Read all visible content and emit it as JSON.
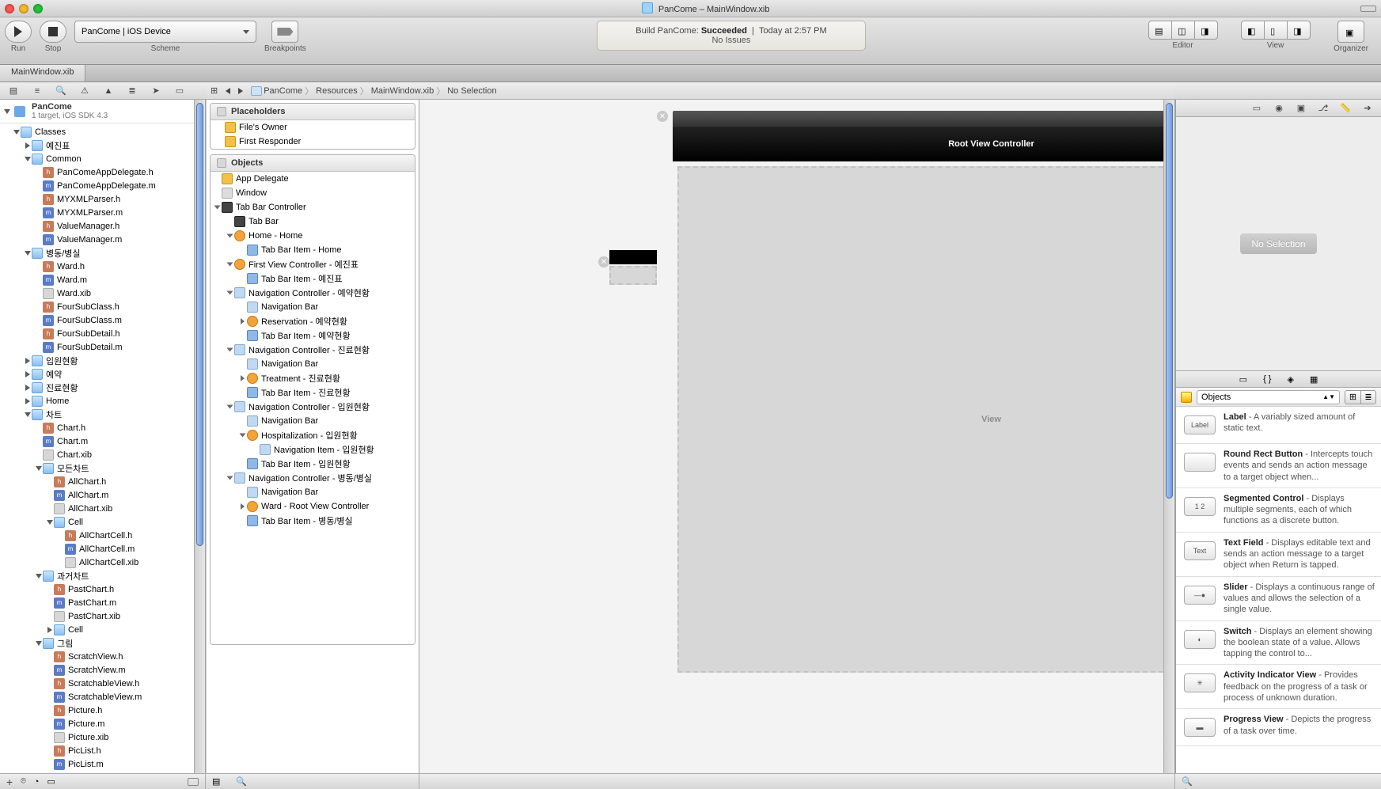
{
  "title": "PanCome – MainWindow.xib",
  "toolbar": {
    "run": "Run",
    "stop": "Stop",
    "scheme_label": "Scheme",
    "scheme_value": "PanCome | iOS Device",
    "breakpoints": "Breakpoints",
    "editor": "Editor",
    "view": "View",
    "organizer": "Organizer",
    "activity_prefix": "Build PanCome: ",
    "activity_status": "Succeeded",
    "activity_time": "Today at 2:57 PM",
    "activity_sub": "No Issues"
  },
  "tab": "MainWindow.xib",
  "breadcrumb": [
    "PanCome",
    "Resources",
    "MainWindow.xib",
    "No Selection"
  ],
  "project": {
    "name": "PanCome",
    "sub": "1 target, iOS SDK 4.3"
  },
  "navTree": [
    {
      "d": 1,
      "t": "folder",
      "o": true,
      "l": "Classes"
    },
    {
      "d": 2,
      "t": "folder",
      "o": false,
      "l": "예진표"
    },
    {
      "d": 2,
      "t": "folder",
      "o": true,
      "l": "Common"
    },
    {
      "d": 3,
      "t": "h",
      "l": "PanComeAppDelegate.h"
    },
    {
      "d": 3,
      "t": "m",
      "l": "PanComeAppDelegate.m"
    },
    {
      "d": 3,
      "t": "h",
      "l": "MYXMLParser.h"
    },
    {
      "d": 3,
      "t": "m",
      "l": "MYXMLParser.m"
    },
    {
      "d": 3,
      "t": "h",
      "l": "ValueManager.h"
    },
    {
      "d": 3,
      "t": "m",
      "l": "ValueManager.m"
    },
    {
      "d": 2,
      "t": "folder",
      "o": true,
      "l": "병동/병실"
    },
    {
      "d": 3,
      "t": "h",
      "l": "Ward.h"
    },
    {
      "d": 3,
      "t": "m",
      "l": "Ward.m"
    },
    {
      "d": 3,
      "t": "xib",
      "l": "Ward.xib"
    },
    {
      "d": 3,
      "t": "h",
      "l": "FourSubClass.h"
    },
    {
      "d": 3,
      "t": "m",
      "l": "FourSubClass.m"
    },
    {
      "d": 3,
      "t": "h",
      "l": "FourSubDetail.h"
    },
    {
      "d": 3,
      "t": "m",
      "l": "FourSubDetail.m"
    },
    {
      "d": 2,
      "t": "folder",
      "o": false,
      "l": "입원현황"
    },
    {
      "d": 2,
      "t": "folder",
      "o": false,
      "l": "예약"
    },
    {
      "d": 2,
      "t": "folder",
      "o": false,
      "l": "진료현황"
    },
    {
      "d": 2,
      "t": "folder",
      "o": false,
      "l": "Home"
    },
    {
      "d": 2,
      "t": "folder",
      "o": true,
      "l": "차트"
    },
    {
      "d": 3,
      "t": "h",
      "l": "Chart.h"
    },
    {
      "d": 3,
      "t": "m",
      "l": "Chart.m"
    },
    {
      "d": 3,
      "t": "xib",
      "l": "Chart.xib"
    },
    {
      "d": 3,
      "t": "folder",
      "o": true,
      "l": "모든차트"
    },
    {
      "d": 4,
      "t": "h",
      "l": "AllChart.h"
    },
    {
      "d": 4,
      "t": "m",
      "l": "AllChart.m"
    },
    {
      "d": 4,
      "t": "xib",
      "l": "AllChart.xib"
    },
    {
      "d": 4,
      "t": "folder",
      "o": true,
      "l": "Cell"
    },
    {
      "d": 5,
      "t": "h",
      "l": "AllChartCell.h"
    },
    {
      "d": 5,
      "t": "m",
      "l": "AllChartCell.m"
    },
    {
      "d": 5,
      "t": "xib",
      "l": "AllChartCell.xib"
    },
    {
      "d": 3,
      "t": "folder",
      "o": true,
      "l": "과거차트"
    },
    {
      "d": 4,
      "t": "h",
      "l": "PastChart.h"
    },
    {
      "d": 4,
      "t": "m",
      "l": "PastChart.m"
    },
    {
      "d": 4,
      "t": "xib",
      "l": "PastChart.xib"
    },
    {
      "d": 4,
      "t": "folder",
      "o": false,
      "l": "Cell"
    },
    {
      "d": 3,
      "t": "folder",
      "o": true,
      "l": "그림"
    },
    {
      "d": 4,
      "t": "h",
      "l": "ScratchView.h"
    },
    {
      "d": 4,
      "t": "m",
      "l": "ScratchView.m"
    },
    {
      "d": 4,
      "t": "h",
      "l": "ScratchableView.h"
    },
    {
      "d": 4,
      "t": "m",
      "l": "ScratchableView.m"
    },
    {
      "d": 4,
      "t": "h",
      "l": "Picture.h"
    },
    {
      "d": 4,
      "t": "m",
      "l": "Picture.m"
    },
    {
      "d": 4,
      "t": "xib",
      "l": "Picture.xib"
    },
    {
      "d": 4,
      "t": "h",
      "l": "PicList.h"
    },
    {
      "d": 4,
      "t": "m",
      "l": "PicList.m"
    }
  ],
  "outline": {
    "placeholders": "Placeholders",
    "ph_items": [
      "File's Owner",
      "First Responder"
    ],
    "objects": "Objects",
    "obj_tree": [
      {
        "d": 0,
        "i": "cube",
        "l": "App Delegate"
      },
      {
        "d": 0,
        "i": "win",
        "l": "Window"
      },
      {
        "d": 0,
        "i": "bar",
        "o": true,
        "l": "Tab Bar Controller"
      },
      {
        "d": 1,
        "i": "bar",
        "l": "Tab Bar"
      },
      {
        "d": 1,
        "i": "orange",
        "o": true,
        "l": "Home - Home"
      },
      {
        "d": 2,
        "i": "blue",
        "l": "Tab Bar Item - Home"
      },
      {
        "d": 1,
        "i": "orange",
        "o": true,
        "l": "First View Controller - 예진표"
      },
      {
        "d": 2,
        "i": "blue",
        "l": "Tab Bar Item - 예진표"
      },
      {
        "d": 1,
        "i": "nav",
        "o": true,
        "l": "Navigation Controller - 예약현황"
      },
      {
        "d": 2,
        "i": "nav",
        "l": "Navigation Bar"
      },
      {
        "d": 2,
        "i": "orange",
        "o": false,
        "l": "Reservation - 예약현황"
      },
      {
        "d": 2,
        "i": "blue",
        "l": "Tab Bar Item - 예약현황"
      },
      {
        "d": 1,
        "i": "nav",
        "o": true,
        "l": "Navigation Controller - 진료현황"
      },
      {
        "d": 2,
        "i": "nav",
        "l": "Navigation Bar"
      },
      {
        "d": 2,
        "i": "orange",
        "o": false,
        "l": "Treatment - 진료현황"
      },
      {
        "d": 2,
        "i": "blue",
        "l": "Tab Bar Item - 진료현황"
      },
      {
        "d": 1,
        "i": "nav",
        "o": true,
        "l": "Navigation Controller - 입원현황"
      },
      {
        "d": 2,
        "i": "nav",
        "l": "Navigation Bar"
      },
      {
        "d": 2,
        "i": "orange",
        "o": true,
        "l": "Hospitalization - 입원현황"
      },
      {
        "d": 3,
        "i": "nav",
        "l": "Navigation Item - 입원현황"
      },
      {
        "d": 2,
        "i": "blue",
        "l": "Tab Bar Item - 입원현황"
      },
      {
        "d": 1,
        "i": "nav",
        "o": true,
        "l": "Navigation Controller - 병동/병실"
      },
      {
        "d": 2,
        "i": "nav",
        "l": "Navigation Bar"
      },
      {
        "d": 2,
        "i": "orange",
        "o": false,
        "l": "Ward - Root View Controller"
      },
      {
        "d": 2,
        "i": "blue",
        "l": "Tab Bar Item - 병동/병실"
      }
    ]
  },
  "canvas": {
    "navTitle": "Root View Controller",
    "viewLabel": "View"
  },
  "inspector": {
    "noSelection": "No Selection",
    "filter": "Objects",
    "lib": [
      {
        "thumb": "Label",
        "title": "Label",
        "desc": " - A variably sized amount of static text."
      },
      {
        "thumb": "",
        "title": "Round Rect Button",
        "desc": " - Intercepts touch events and sends an action message to a target object when..."
      },
      {
        "thumb": "1 2",
        "title": "Segmented Control",
        "desc": " - Displays multiple segments, each of which functions as a discrete button."
      },
      {
        "thumb": "Text",
        "title": "Text Field",
        "desc": " - Displays editable text and sends an action message to a target object when Return is tapped."
      },
      {
        "thumb": "—●",
        "title": "Slider",
        "desc": " - Displays a continuous range of values and allows the selection of a single value."
      },
      {
        "thumb": "◐",
        "title": "Switch",
        "desc": " - Displays an element showing the boolean state of a value. Allows tapping the control to..."
      },
      {
        "thumb": "✳",
        "title": "Activity Indicator View",
        "desc": " - Provides feedback on the progress of a task or process of unknown duration."
      },
      {
        "thumb": "▬",
        "title": "Progress View",
        "desc": " - Depicts the progress of a task over time."
      }
    ]
  }
}
